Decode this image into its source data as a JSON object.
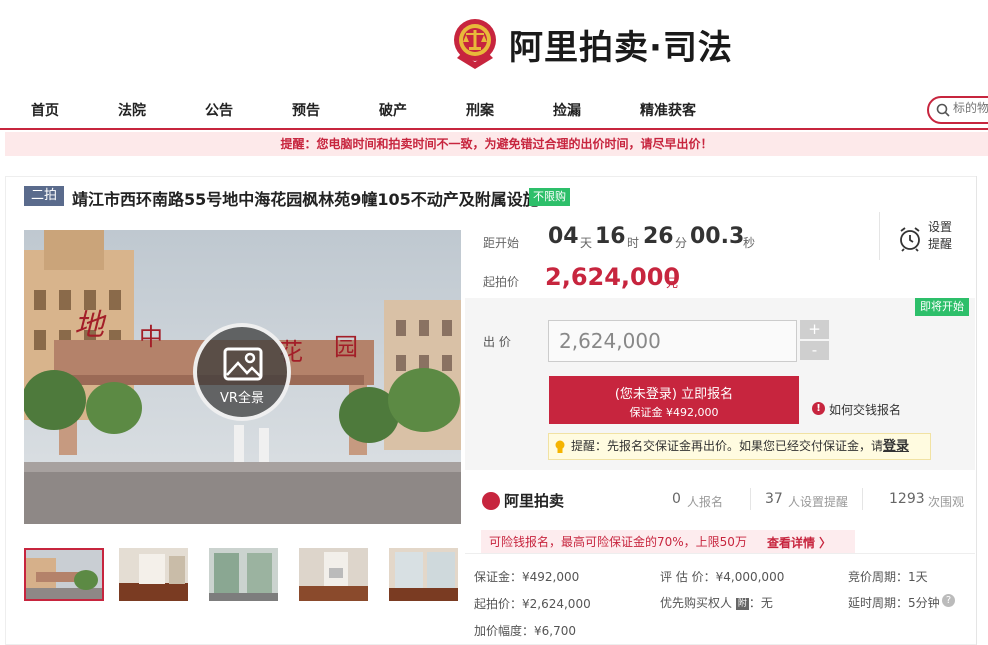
{
  "header": {
    "logo_text": "阿里拍卖·司法"
  },
  "nav": {
    "items": [
      "首页",
      "法院",
      "公告",
      "预告",
      "破产",
      "刑案",
      "捡漏",
      "精准获客"
    ]
  },
  "search": {
    "placeholder": "标的物"
  },
  "notice": "提醒：您电脑时间和拍卖时间不一致，为避免错过合理的出价时间，请尽早出价！",
  "item": {
    "round": "二拍",
    "title": "靖江市西环南路55号地中海花园枫林苑9幢105不动产及附属设施",
    "tag": "不限购",
    "vr_label": "VR全景"
  },
  "countdown": {
    "label": "距开始",
    "days": "04",
    "days_unit": "天",
    "hours": "16",
    "hours_unit": "时",
    "minutes": "26",
    "minutes_unit": "分",
    "seconds": "00.3",
    "seconds_unit": "秒"
  },
  "start_price": {
    "label": "起拍价",
    "value": "2,624,000",
    "unit": "元"
  },
  "remind": {
    "label": "设置提醒"
  },
  "bid": {
    "soon_badge": "即将开始",
    "label": "出 价",
    "input_value": "2,624,000",
    "plus": "+",
    "minus": "-",
    "register_line1": "(您未登录) 立即报名",
    "register_line2": "保证金 ¥492,000",
    "offline_link": "如何交钱报名",
    "info_mark": "!",
    "tip_text": "提醒：先报名交保证金再出价。如果您已经交付保证金，请",
    "tip_login": "登录"
  },
  "stats": {
    "logo": "阿里拍卖",
    "signups": "0",
    "signups_label": "人报名",
    "reminders": "37",
    "reminders_label": "人设置提醒",
    "views": "1293",
    "views_label": "次围观"
  },
  "risk": {
    "text": "可险钱报名，最高可险保证金的70%，上限50万",
    "detail": "查看详情 〉"
  },
  "details": {
    "deposit": "保证金：¥492,000",
    "appraisal": "评 估 价：¥4,000,000",
    "cycle": "竞价周期：1天",
    "start": "起拍价：¥2,624,000",
    "priority_label": "优先购买权人",
    "priority_tag": "附",
    "priority_value": "：无",
    "delay": "延时周期：5分钟",
    "help": "?",
    "increment": "加价幅度：¥6,700"
  },
  "colors": {
    "brand": "#c7253e",
    "badge_green": "#2dbf6a",
    "round_badge": "#5a6b8c"
  }
}
